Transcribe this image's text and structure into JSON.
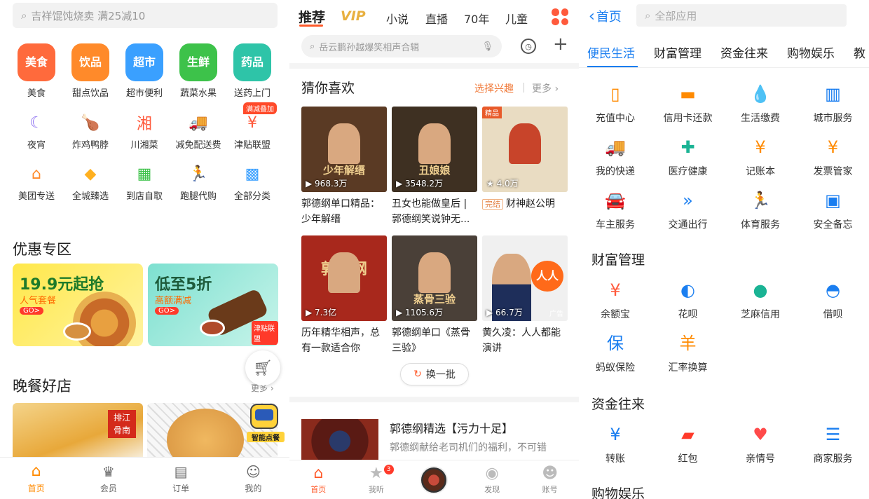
{
  "p1": {
    "search_placeholder": "吉祥馄饨烧卖 满25减10",
    "big_categories": [
      {
        "icon_text": "美食",
        "label": "美食",
        "color": "#ff6a3c"
      },
      {
        "icon_text": "饮品",
        "label": "甜点饮品",
        "color": "#ff8a2a"
      },
      {
        "icon_text": "超市",
        "label": "超市便利",
        "color": "#3aa0ff"
      },
      {
        "icon_text": "生鲜",
        "label": "蔬菜水果",
        "color": "#3dc24a"
      },
      {
        "icon_text": "药品",
        "label": "送药上门",
        "color": "#2ec4a8"
      }
    ],
    "small_categories_row1": [
      {
        "icon": "moon-icon",
        "glyph": "☾",
        "label": "夜宵",
        "color": "#8a6cf0"
      },
      {
        "icon": "drumstick-icon",
        "glyph": "🍗",
        "label": "炸鸡鸭脖",
        "color": "#ff8a2a"
      },
      {
        "icon": "hunan-icon",
        "glyph": "湘",
        "label": "川湘菜",
        "color": "#ff5a3c"
      },
      {
        "icon": "truck-icon",
        "glyph": "🚚",
        "label": "减免配送费",
        "color": "#3aa0ff"
      },
      {
        "icon": "bag-icon",
        "glyph": "¥",
        "label": "津贴联盟",
        "color": "#ff5a3c"
      }
    ],
    "small_badge": "满减叠加",
    "small_categories_row2": [
      {
        "icon": "house-icon",
        "glyph": "⌂",
        "label": "美团专送",
        "color": "#ff8a2a"
      },
      {
        "icon": "diamond-icon",
        "glyph": "◆",
        "label": "全城臻选",
        "color": "#ffb020"
      },
      {
        "icon": "store-icon",
        "glyph": "▦",
        "label": "到店自取",
        "color": "#3dc24a"
      },
      {
        "icon": "runner-icon",
        "glyph": "🏃",
        "label": "跑腿代购",
        "color": "#ff5a3c"
      },
      {
        "icon": "grid-icon",
        "glyph": "▩",
        "label": "全部分类",
        "color": "#3aa0ff"
      }
    ],
    "promo_title": "优惠专区",
    "promo1": {
      "big": "19.9元起抢",
      "sub": "人气套餐",
      "go": "GO>"
    },
    "promo2": {
      "big": "低至5折",
      "sub": "高额满减",
      "go": "GO>",
      "badge": "津贴联盟"
    },
    "dinner_title": "晚餐好店",
    "more": "更多 ›",
    "smart_order": "智能点餐",
    "tabs": [
      "首页",
      "会员",
      "订单",
      "我的"
    ]
  },
  "p2": {
    "nav": [
      "推荐",
      "VIP",
      "小说",
      "直播",
      "70年",
      "儿童"
    ],
    "search_placeholder": "岳云鹏孙越爆笑相声合辑",
    "guess_title": "猜你喜欢",
    "choose_interest": "选择兴趣",
    "more": "更多 ›",
    "cards": [
      {
        "plays": "968.3万",
        "caption": "郭德纲单口精品：少年解缙",
        "overlay": "少年解缙",
        "bg": "#5a3a24"
      },
      {
        "plays": "3548.2万",
        "caption": "丑女也能做皇后 | 郭德纲笑说钟无...",
        "overlay": "丑娘娘",
        "bg": "#3e3022"
      },
      {
        "plays": "4.0万",
        "caption": "财神赵公明",
        "tag": "完结",
        "top_tag": "精品",
        "bg": "#e9dcc2"
      },
      {
        "plays": "7.3亿",
        "caption": "历年精华相声，总有一款适合你",
        "overlay": "郭德纲",
        "bg": "#a8281c"
      },
      {
        "plays": "1105.6万",
        "caption": "郭德纲单口《蒸骨三验》",
        "overlay": "蒸骨三验",
        "bg": "#4a4038"
      },
      {
        "plays": "66.7万",
        "caption": "黄久凌：人人都能演讲",
        "overlay": "人人",
        "ad": "广告",
        "bg": "#f0f0f0"
      }
    ],
    "refresh": "换一批",
    "featured_title": "郭德纲精选【污力十足】",
    "featured_desc": "郭德纲献给老司机们的福利，不可错",
    "tabs": [
      "首页",
      "我听",
      "",
      "发现",
      "账号"
    ],
    "badge_count": "3"
  },
  "p3": {
    "back": "首页",
    "search_placeholder": "全部应用",
    "tabs": [
      "便民生活",
      "财富管理",
      "资金往来",
      "购物娱乐",
      "教"
    ],
    "sec1": [
      {
        "icon": "phone-icon",
        "glyph": "▯",
        "label": "充值中心",
        "color": "#ff8a00"
      },
      {
        "icon": "card-icon",
        "glyph": "▬",
        "label": "信用卡还款",
        "color": "#ff8a00"
      },
      {
        "icon": "drop-icon",
        "glyph": "💧",
        "label": "生活缴费",
        "color": "#1a7ef0"
      },
      {
        "icon": "building-icon",
        "glyph": "▥",
        "label": "城市服务",
        "color": "#1a7ef0"
      },
      {
        "icon": "truck-icon",
        "glyph": "🚚",
        "label": "我的快递",
        "color": "#ff8a00"
      },
      {
        "icon": "health-icon",
        "glyph": "✚",
        "label": "医疗健康",
        "color": "#1ab394"
      },
      {
        "icon": "ledger-icon",
        "glyph": "¥",
        "label": "记账本",
        "color": "#ff8a00"
      },
      {
        "icon": "invoice-icon",
        "glyph": "¥",
        "label": "发票管家",
        "color": "#ff8a00"
      },
      {
        "icon": "car-icon",
        "glyph": "🚘",
        "label": "车主服务",
        "color": "#1a7ef0"
      },
      {
        "icon": "arrows-icon",
        "glyph": "»",
        "label": "交通出行",
        "color": "#1a7ef0"
      },
      {
        "icon": "sport-icon",
        "glyph": "🏃",
        "label": "体育服务",
        "color": "#ff4a2a"
      },
      {
        "icon": "safe-icon",
        "glyph": "▣",
        "label": "安全备忘",
        "color": "#1a7ef0"
      }
    ],
    "sec2_title": "财富管理",
    "sec2": [
      {
        "icon": "yuebao-icon",
        "glyph": "¥",
        "label": "余额宝",
        "color": "#ff5a3c"
      },
      {
        "icon": "huabei-icon",
        "glyph": "◐",
        "label": "花呗",
        "color": "#1a7ef0"
      },
      {
        "icon": "sesame-icon",
        "glyph": "●",
        "label": "芝麻信用",
        "color": "#1ab394"
      },
      {
        "icon": "jiebei-icon",
        "glyph": "◓",
        "label": "借呗",
        "color": "#1a7ef0"
      },
      {
        "icon": "insurance-icon",
        "glyph": "保",
        "label": "蚂蚁保险",
        "color": "#1a7ef0"
      },
      {
        "icon": "exchange-icon",
        "glyph": "羊",
        "label": "汇率换算",
        "color": "#ff8a00"
      }
    ],
    "sec3_title": "资金往来",
    "sec3": [
      {
        "icon": "transfer-icon",
        "glyph": "¥",
        "label": "转账",
        "color": "#1a7ef0"
      },
      {
        "icon": "redpacket-icon",
        "glyph": "▰",
        "label": "红包",
        "color": "#ff3a2a"
      },
      {
        "icon": "family-icon",
        "glyph": "♥",
        "label": "亲情号",
        "color": "#ff4a4a"
      },
      {
        "icon": "merchant-icon",
        "glyph": "☰",
        "label": "商家服务",
        "color": "#1a7ef0"
      }
    ],
    "sec4_title": "购物娱乐"
  }
}
